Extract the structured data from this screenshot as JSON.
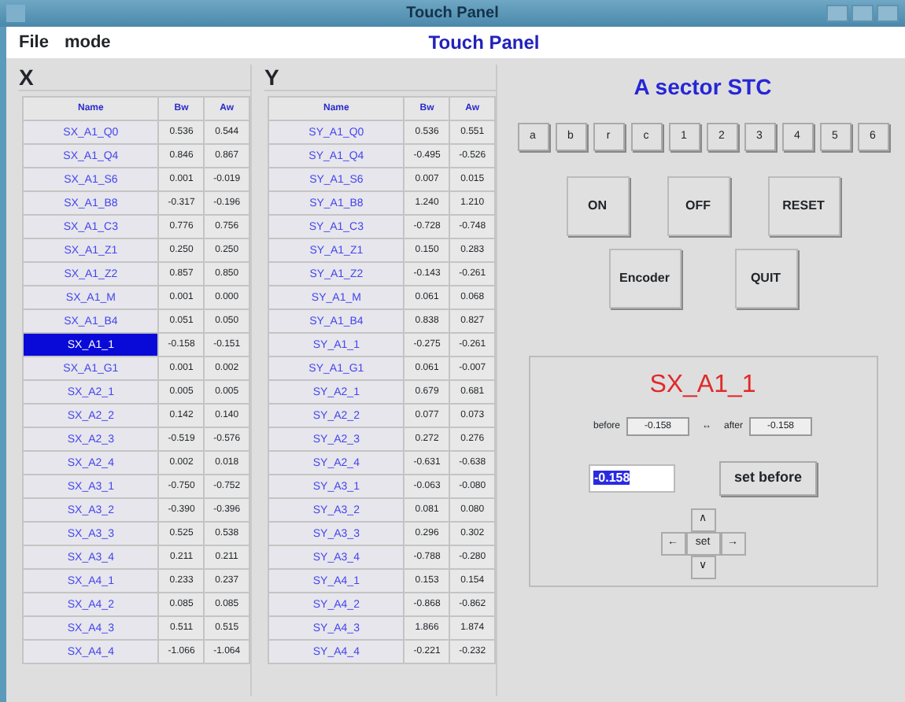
{
  "window": {
    "title": "Touch Panel"
  },
  "menu": [
    "File",
    "mode"
  ],
  "header_title": "Touch Panel",
  "tables": [
    {
      "label": "X",
      "columns": [
        "Name",
        "Bw",
        "Aw"
      ],
      "rows": [
        {
          "name": "SX_A1_Q0",
          "bw": "0.536",
          "aw": "0.544",
          "selected": false
        },
        {
          "name": "SX_A1_Q4",
          "bw": "0.846",
          "aw": "0.867",
          "selected": false
        },
        {
          "name": "SX_A1_S6",
          "bw": "0.001",
          "aw": "-0.019",
          "selected": false
        },
        {
          "name": "SX_A1_B8",
          "bw": "-0.317",
          "aw": "-0.196",
          "selected": false
        },
        {
          "name": "SX_A1_C3",
          "bw": "0.776",
          "aw": "0.756",
          "selected": false
        },
        {
          "name": "SX_A1_Z1",
          "bw": "0.250",
          "aw": "0.250",
          "selected": false
        },
        {
          "name": "SX_A1_Z2",
          "bw": "0.857",
          "aw": "0.850",
          "selected": false
        },
        {
          "name": "SX_A1_M",
          "bw": "0.001",
          "aw": "0.000",
          "selected": false
        },
        {
          "name": "SX_A1_B4",
          "bw": "0.051",
          "aw": "0.050",
          "selected": false
        },
        {
          "name": "SX_A1_1",
          "bw": "-0.158",
          "aw": "-0.151",
          "selected": true
        },
        {
          "name": "SX_A1_G1",
          "bw": "0.001",
          "aw": "0.002",
          "selected": false
        },
        {
          "name": "SX_A2_1",
          "bw": "0.005",
          "aw": "0.005",
          "selected": false
        },
        {
          "name": "SX_A2_2",
          "bw": "0.142",
          "aw": "0.140",
          "selected": false
        },
        {
          "name": "SX_A2_3",
          "bw": "-0.519",
          "aw": "-0.576",
          "selected": false
        },
        {
          "name": "SX_A2_4",
          "bw": "0.002",
          "aw": "0.018",
          "selected": false
        },
        {
          "name": "SX_A3_1",
          "bw": "-0.750",
          "aw": "-0.752",
          "selected": false
        },
        {
          "name": "SX_A3_2",
          "bw": "-0.390",
          "aw": "-0.396",
          "selected": false
        },
        {
          "name": "SX_A3_3",
          "bw": "0.525",
          "aw": "0.538",
          "selected": false
        },
        {
          "name": "SX_A3_4",
          "bw": "0.211",
          "aw": "0.211",
          "selected": false
        },
        {
          "name": "SX_A4_1",
          "bw": "0.233",
          "aw": "0.237",
          "selected": false
        },
        {
          "name": "SX_A4_2",
          "bw": "0.085",
          "aw": "0.085",
          "selected": false
        },
        {
          "name": "SX_A4_3",
          "bw": "0.511",
          "aw": "0.515",
          "selected": false
        },
        {
          "name": "SX_A4_4",
          "bw": "-1.066",
          "aw": "-1.064",
          "selected": false
        }
      ]
    },
    {
      "label": "Y",
      "columns": [
        "Name",
        "Bw",
        "Aw"
      ],
      "rows": [
        {
          "name": "SY_A1_Q0",
          "bw": "0.536",
          "aw": "0.551",
          "selected": false
        },
        {
          "name": "SY_A1_Q4",
          "bw": "-0.495",
          "aw": "-0.526",
          "selected": false
        },
        {
          "name": "SY_A1_S6",
          "bw": "0.007",
          "aw": "0.015",
          "selected": false
        },
        {
          "name": "SY_A1_B8",
          "bw": "1.240",
          "aw": "1.210",
          "selected": false
        },
        {
          "name": "SY_A1_C3",
          "bw": "-0.728",
          "aw": "-0.748",
          "selected": false
        },
        {
          "name": "SY_A1_Z1",
          "bw": "0.150",
          "aw": "0.283",
          "selected": false
        },
        {
          "name": "SY_A1_Z2",
          "bw": "-0.143",
          "aw": "-0.261",
          "selected": false
        },
        {
          "name": "SY_A1_M",
          "bw": "0.061",
          "aw": "0.068",
          "selected": false
        },
        {
          "name": "SY_A1_B4",
          "bw": "0.838",
          "aw": "0.827",
          "selected": false
        },
        {
          "name": "SY_A1_1",
          "bw": "-0.275",
          "aw": "-0.261",
          "selected": false
        },
        {
          "name": "SY_A1_G1",
          "bw": "0.061",
          "aw": "-0.007",
          "selected": false
        },
        {
          "name": "SY_A2_1",
          "bw": "0.679",
          "aw": "0.681",
          "selected": false
        },
        {
          "name": "SY_A2_2",
          "bw": "0.077",
          "aw": "0.073",
          "selected": false
        },
        {
          "name": "SY_A2_3",
          "bw": "0.272",
          "aw": "0.276",
          "selected": false
        },
        {
          "name": "SY_A2_4",
          "bw": "-0.631",
          "aw": "-0.638",
          "selected": false
        },
        {
          "name": "SY_A3_1",
          "bw": "-0.063",
          "aw": "-0.080",
          "selected": false
        },
        {
          "name": "SY_A3_2",
          "bw": "0.081",
          "aw": "0.080",
          "selected": false
        },
        {
          "name": "SY_A3_3",
          "bw": "0.296",
          "aw": "0.302",
          "selected": false
        },
        {
          "name": "SY_A3_4",
          "bw": "-0.788",
          "aw": "-0.280",
          "selected": false
        },
        {
          "name": "SY_A4_1",
          "bw": "0.153",
          "aw": "0.154",
          "selected": false
        },
        {
          "name": "SY_A4_2",
          "bw": "-0.868",
          "aw": "-0.862",
          "selected": false
        },
        {
          "name": "SY_A4_3",
          "bw": "1.866",
          "aw": "1.874",
          "selected": false
        },
        {
          "name": "SY_A4_4",
          "bw": "-0.221",
          "aw": "-0.232",
          "selected": false
        }
      ]
    }
  ],
  "control": {
    "title": "A sector STC",
    "keys": [
      "a",
      "b",
      "r",
      "c",
      "1",
      "2",
      "3",
      "4",
      "5",
      "6"
    ],
    "buttons": [
      [
        "ON",
        "OFF",
        "RESET"
      ],
      [
        "Encoder",
        "QUIT"
      ]
    ],
    "editor": {
      "title": "SX_A1_1",
      "before_label": "before",
      "before_value": "-0.158",
      "arrow": "↔",
      "after_label": "after",
      "after_value": "-0.158",
      "input_value": "-0.158",
      "set_before": "set before",
      "up": "∧",
      "left": "←",
      "set": "set",
      "right": "→",
      "down": "∨"
    }
  }
}
